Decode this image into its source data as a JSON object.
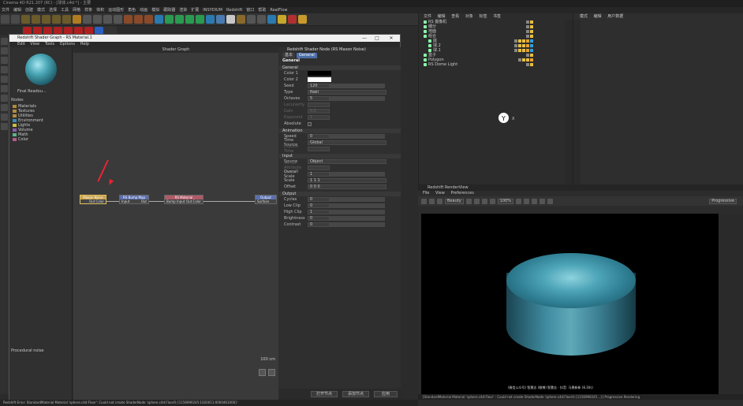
{
  "app": {
    "title": "Cinema 4D R21.207 (RC) - [球体.c4d *] - 主要",
    "menu": [
      "文件",
      "编辑",
      "创建",
      "模式",
      "选择",
      "工具",
      "网格",
      "样条",
      "体积",
      "运动图形",
      "角色",
      "动画",
      "模拟",
      "跟踪器",
      "渲染",
      "扩展",
      "INSYDIUM",
      "Redshift",
      "窗口",
      "帮助",
      "RealFlow"
    ],
    "status_error": "Redshift Error: StandardMaterial Material 'sphere.c4d:Floor': Could not create ShaderNode 'sphere.c4d:Floor0:{1156990245:1020011:0000461000}'"
  },
  "shader_graph": {
    "window_title": "Redshift Shader Graph - RS Material.1",
    "window_buttons": [
      "—",
      "□",
      "✕"
    ],
    "menu": [
      "Edit",
      "View",
      "Tools",
      "Options",
      "Help"
    ],
    "preview_label": "Final Readou...",
    "nodes_label": "Nodes",
    "tree": [
      "Materials",
      "Textures",
      "Utilities",
      "Environment",
      "Lights",
      "Volume",
      "Math",
      "Color"
    ],
    "procedural_label": "Procedural noise",
    "canvas_title": "Shader Graph",
    "scale_label": "100 cm",
    "nodes": [
      {
        "title": "Maxon Noise",
        "port_left": "",
        "port_right": "Out Color",
        "color": "#c9a24a"
      },
      {
        "title": "RS Bump Map",
        "port_left": "Input",
        "port_right": "Out",
        "color": "#5a6fb0"
      },
      {
        "title": "RS Material",
        "port_left": "Bump Input",
        "port_right": "Out Color",
        "color": "#b05a68"
      },
      {
        "title": "Output",
        "port_left": "Surface",
        "port_right": "",
        "color": "#5a6fb0"
      }
    ],
    "attr_title": "Redshift Shader Node (RS Maxon Noise)",
    "attr_tabs": [
      "基本",
      "General"
    ],
    "attr_heading": "General",
    "sections": {
      "general": "General",
      "animation": "Animation",
      "input": "Input",
      "output": "Output"
    },
    "props_general": [
      {
        "label": "Color 1",
        "value": "",
        "type": "swatch",
        "color": "#000000"
      },
      {
        "label": "Color 2",
        "value": "",
        "type": "swatch",
        "color": "#ffffff"
      },
      {
        "label": "Seed",
        "value": "120",
        "type": "num"
      },
      {
        "label": "Type",
        "value": "Naki",
        "type": "drop"
      },
      {
        "label": "Octaves",
        "value": "5",
        "type": "num"
      },
      {
        "label": "Lacunarity",
        "value": "",
        "type": "dim"
      },
      {
        "label": "Gain",
        "value": "0.5",
        "type": "dim"
      },
      {
        "label": "Exponent",
        "value": "1",
        "type": "dim"
      },
      {
        "label": "Absolute",
        "value": "",
        "type": "check"
      }
    ],
    "props_animation": [
      {
        "label": "Speed",
        "value": "0",
        "type": "num"
      },
      {
        "label": "Time Source",
        "value": "Global",
        "type": "drop"
      },
      {
        "label": "Explicit Time",
        "value": "",
        "type": "dim"
      }
    ],
    "props_input": [
      {
        "label": "Source",
        "value": "Object",
        "type": "drop"
      },
      {
        "label": "Vertex Attribute Name",
        "value": "",
        "type": "dim"
      },
      {
        "label": "Overall Scale",
        "value": "1",
        "type": "num"
      },
      {
        "label": "Scale",
        "value": "1   1   1",
        "type": "vec"
      },
      {
        "label": "Offset",
        "value": "0   0   0",
        "type": "vec"
      }
    ],
    "props_output": [
      {
        "label": "Cycles",
        "value": "0",
        "type": "num"
      },
      {
        "label": "Low Clip",
        "value": "0",
        "type": "num"
      },
      {
        "label": "High Clip",
        "value": "1",
        "type": "num"
      },
      {
        "label": "Brightness",
        "value": "0",
        "type": "num"
      },
      {
        "label": "Contrast",
        "value": "0",
        "type": "num"
      }
    ],
    "bottom_buttons": [
      "打开节点",
      "添加节点",
      "应用"
    ]
  },
  "object_manager": {
    "menu": [
      "文件",
      "编辑",
      "查看",
      "对象",
      "标签",
      "书签"
    ],
    "rows": [
      {
        "name": "RS 摄像机",
        "indent": 0
      },
      {
        "name": "细分",
        "indent": 0
      },
      {
        "name": "地面",
        "indent": 0
      },
      {
        "name": "组合",
        "indent": 0
      },
      {
        "name": "底",
        "indent": 1
      },
      {
        "name": "球.2",
        "indent": 1
      },
      {
        "name": "球.1",
        "indent": 1
      },
      {
        "name": "盒子",
        "indent": 0
      },
      {
        "name": "Polygon",
        "indent": 0
      },
      {
        "name": "RS Dome Light",
        "indent": 0
      }
    ],
    "cursor_glyph": "Y",
    "cursor_label": "X"
  },
  "attributes_manager": {
    "menu": [
      "模式",
      "编辑",
      "用户数据"
    ]
  },
  "render_view": {
    "title": "Redshift RenderView",
    "menu": [
      "File",
      "View",
      "Preferences"
    ],
    "beauty_label": "Beauty",
    "zoom_label": "100%",
    "mode_label": "Progressive",
    "caption": "(微信公众号) 智慧志 (微博) 智慧志 · 抖音: 马景新新  (8.30s)",
    "status": "[StandardMaterial Material 'sphere.c4d:Floor' : Could not create ShaderNode 'sphere.c4d:Floor0:{1156990245...}]   Progressive Rendering"
  }
}
